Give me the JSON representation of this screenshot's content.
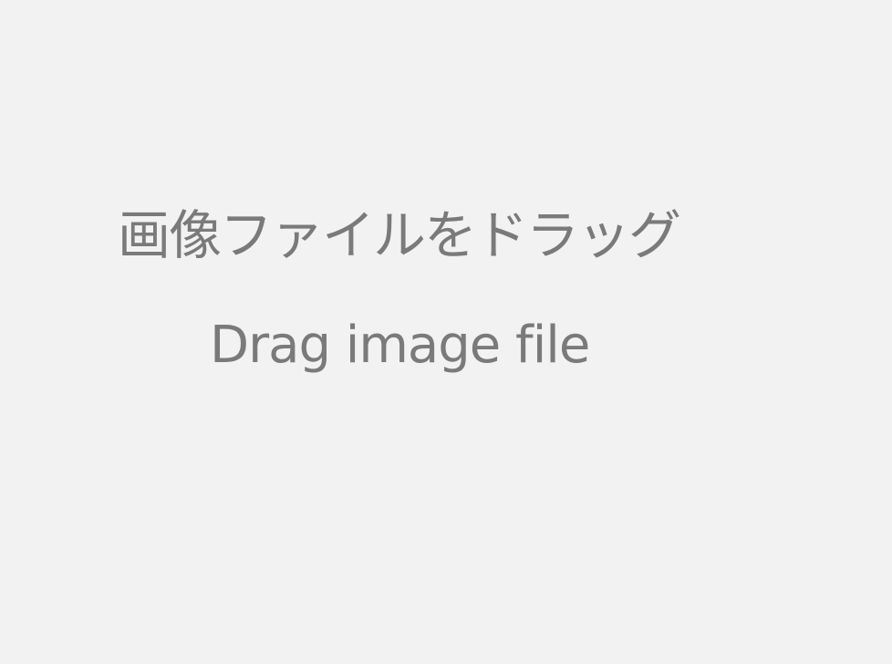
{
  "drop_zone": {
    "instruction_ja": "画像ファイルをドラッグ",
    "instruction_en": "Drag image file"
  },
  "colors": {
    "background": "#f2f2f2",
    "text": "#7a7a7a"
  }
}
